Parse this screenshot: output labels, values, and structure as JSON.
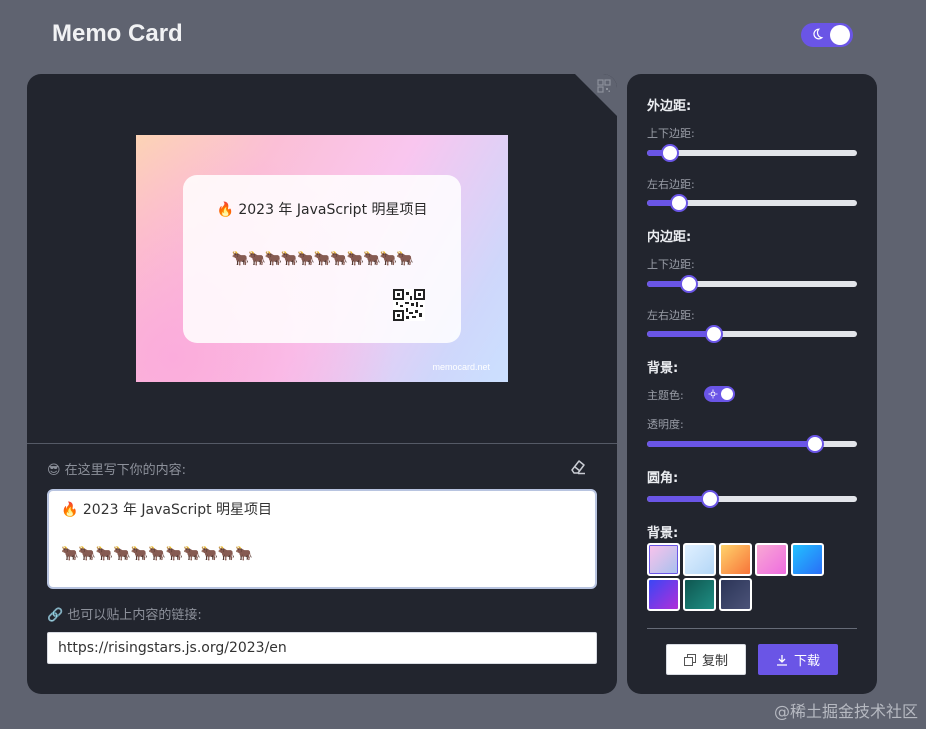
{
  "app": {
    "title": "Memo Card"
  },
  "theme_toggle": {
    "state": "dark"
  },
  "preview": {
    "title": "🔥 2023 年 JavaScript 明星项目",
    "emoji_line": "🐂🐂🐂🐂🐂🐂🐂🐂🐂🐂🐂",
    "site": "memocard.net"
  },
  "editor": {
    "content_label": "😎 在这里写下你的内容:",
    "content_value": "🔥 2023 年 JavaScript 明星项目\n\n🐂🐂🐂🐂🐂🐂🐂🐂🐂🐂🐂",
    "link_label": "🔗 也可以贴上内容的链接:",
    "link_value": "https://risingstars.js.org/2023/en"
  },
  "settings": {
    "outer_margin": {
      "title": "外边距:",
      "vertical_label": "上下边距:",
      "vertical_value": 0.11,
      "horizontal_label": "左右边距:",
      "horizontal_value": 0.15
    },
    "inner_padding": {
      "title": "内边距:",
      "vertical_label": "上下边距:",
      "vertical_value": 0.2,
      "horizontal_label": "左右边距:",
      "horizontal_value": 0.32
    },
    "background": {
      "title": "背景:",
      "theme_label": "主题色:",
      "opacity_label": "透明度:",
      "opacity_value": 0.8
    },
    "radius": {
      "title": "圆角:",
      "value": 0.3
    },
    "palette": {
      "title": "背景:",
      "swatches": [
        {
          "name": "pastel-pink-blue",
          "colors": [
            "#fbc2eb",
            "#a6c1ee"
          ]
        },
        {
          "name": "light-blue",
          "colors": [
            "#e0f0ff",
            "#b4d7f7"
          ]
        },
        {
          "name": "orange",
          "colors": [
            "#ffd36b",
            "#f7743a"
          ]
        },
        {
          "name": "pink",
          "colors": [
            "#f9a8d4",
            "#ee6ce0"
          ]
        },
        {
          "name": "blue",
          "colors": [
            "#22c1ff",
            "#2a6ef7"
          ]
        },
        {
          "name": "violet-blue",
          "colors": [
            "#3b46f5",
            "#b02fd9"
          ]
        },
        {
          "name": "teal",
          "colors": [
            "#0f5650",
            "#1f8f84"
          ]
        },
        {
          "name": "navy",
          "colors": [
            "#2c3558",
            "#4b5378"
          ]
        }
      ]
    },
    "copy_label": "复制",
    "download_label": "下载"
  },
  "footer": {
    "watermark": "@稀土掘金技术社区"
  },
  "colors": {
    "accent": "#6a55e6",
    "panel": "#22252e",
    "page": "#5f6370"
  }
}
